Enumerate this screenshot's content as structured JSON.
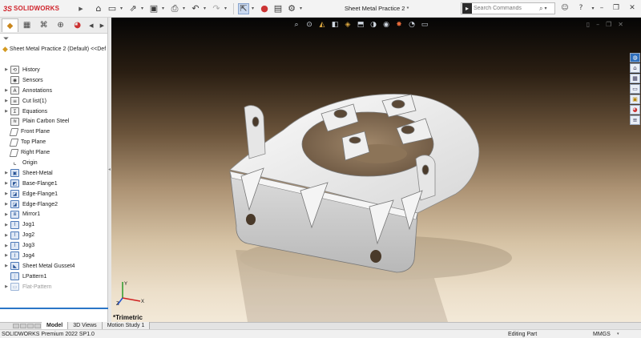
{
  "app": {
    "brand_ds": "3S",
    "brand_name": "SOLIDWORKS",
    "document_title": "Sheet Metal Practice 2 *"
  },
  "search": {
    "placeholder": "Search Commands",
    "icon": "command-search-icon"
  },
  "toolbar": {
    "icons": [
      "home-icon",
      "new-document-icon",
      "open-icon",
      "save-icon",
      "print-icon",
      "undo-icon",
      "redo-icon",
      "select-icon",
      "rebuild-icon",
      "file-properties-icon",
      "options-icon"
    ]
  },
  "right_controls": {
    "icons": [
      "user-icon",
      "help-icon",
      "minimize-icon",
      "restore-icon",
      "close-icon"
    ]
  },
  "feature_manager": {
    "tabs": [
      "feature-manager-tab",
      "property-manager-tab",
      "configuration-manager-tab",
      "display-manager-tab"
    ],
    "root_label": "Sheet Metal Practice 2 (Default) <<Def",
    "items": [
      {
        "label": "History",
        "icon": "history-icon",
        "expand": true,
        "kind": "folder"
      },
      {
        "label": "Sensors",
        "icon": "sensors-icon",
        "expand": false,
        "kind": "folder"
      },
      {
        "label": "Annotations",
        "icon": "annotations-icon",
        "expand": true,
        "kind": "folder"
      },
      {
        "label": "Cut list(1)",
        "icon": "cut-list-icon",
        "expand": true,
        "kind": "folder"
      },
      {
        "label": "Equations",
        "icon": "equations-icon",
        "expand": true,
        "kind": "folder"
      },
      {
        "label": "Plain Carbon Steel",
        "icon": "material-icon",
        "expand": false,
        "kind": "material"
      },
      {
        "label": "Front Plane",
        "icon": "plane-icon",
        "expand": false,
        "kind": "plane"
      },
      {
        "label": "Top Plane",
        "icon": "plane-icon",
        "expand": false,
        "kind": "plane"
      },
      {
        "label": "Right Plane",
        "icon": "plane-icon",
        "expand": false,
        "kind": "plane"
      },
      {
        "label": "Origin",
        "icon": "origin-icon",
        "expand": false,
        "kind": "origin"
      },
      {
        "label": "Sheet-Metal",
        "icon": "sheet-metal-icon",
        "expand": true,
        "kind": "feature"
      },
      {
        "label": "Base-Flange1",
        "icon": "base-flange-icon",
        "expand": true,
        "kind": "feature"
      },
      {
        "label": "Edge-Flange1",
        "icon": "edge-flange-icon",
        "expand": true,
        "kind": "feature"
      },
      {
        "label": "Edge-Flange2",
        "icon": "edge-flange-icon",
        "expand": true,
        "kind": "feature"
      },
      {
        "label": "Mirror1",
        "icon": "mirror-icon",
        "expand": true,
        "kind": "feature"
      },
      {
        "label": "Jog1",
        "icon": "jog-icon",
        "expand": true,
        "kind": "feature"
      },
      {
        "label": "Jog2",
        "icon": "jog-icon",
        "expand": true,
        "kind": "feature"
      },
      {
        "label": "Jog3",
        "icon": "jog-icon",
        "expand": true,
        "kind": "feature"
      },
      {
        "label": "Jog4",
        "icon": "jog-icon",
        "expand": true,
        "kind": "feature"
      },
      {
        "label": "Sheet Metal Gusset4",
        "icon": "gusset-icon",
        "expand": true,
        "kind": "feature"
      },
      {
        "label": "LPattern1",
        "icon": "linear-pattern-icon",
        "expand": false,
        "kind": "feature"
      },
      {
        "label": "Flat-Pattern",
        "icon": "flat-pattern-icon",
        "expand": true,
        "kind": "suppressed"
      }
    ]
  },
  "viewport": {
    "view_label": "*Trimetric",
    "headsup_icons": [
      "zoom-to-fit-icon",
      "zoom-area-icon",
      "previous-view-icon",
      "section-view-icon",
      "dynamic-annotation-icon",
      "view-orientation-icon",
      "display-style-icon",
      "hide-show-icon",
      "edit-appearance-icon",
      "apply-scene-icon",
      "view-settings-icon"
    ],
    "task_pane_icons": [
      "resources-icon",
      "design-library-icon",
      "file-explorer-icon",
      "view-palette-icon",
      "appearances-icon",
      "custom-properties-icon"
    ],
    "part_color": "#e6e6e6"
  },
  "bottom_tabs": {
    "items": [
      "Model",
      "3D Views",
      "Motion Study 1"
    ],
    "active": "Model"
  },
  "status": {
    "version": "SOLIDWORKS Premium 2022 SP1.0",
    "mode": "Editing Part",
    "units": "MMGS"
  }
}
